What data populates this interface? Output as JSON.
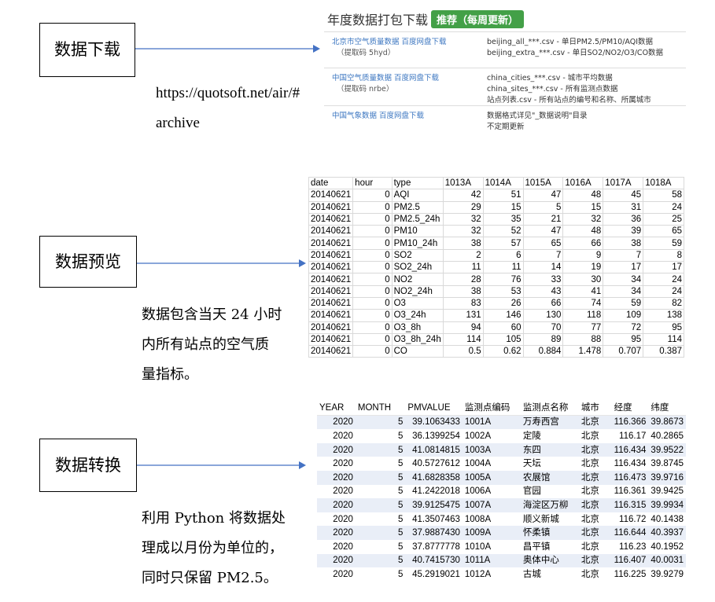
{
  "labels": {
    "download": "数据下载",
    "preview": "数据预览",
    "transform": "数据转换"
  },
  "url_text": [
    "https://quotsoft.net/air/#",
    "archive"
  ],
  "preview_desc": [
    "数据包含当天 24 小时",
    "内所有站点的空气质",
    "量指标。"
  ],
  "transform_desc": [
    "利用 Python 将数据处",
    "理成以月份为单位的，",
    "同时只保留 PM2.5。"
  ],
  "download_panel": {
    "title": "年度数据打包下载",
    "badge": "推荐（每周更新）",
    "rows": [
      {
        "link": "北京市空气质量数据 百度网盘下载",
        "code": "（提取码 5hyd）",
        "desc": [
          "beijing_all_***.csv - 单日PM2.5/PM10/AQI数据",
          "beijing_extra_***.csv - 单日SO2/NO2/O3/CO数据"
        ]
      },
      {
        "link": "中国空气质量数据 百度网盘下载",
        "code": "（提取码 nrbe）",
        "desc": [
          "china_cities_***.csv - 城市平均数据",
          "china_sites_***.csv - 所有监测点数据",
          "站点列表.csv - 所有站点的编号和名称、所属城市"
        ]
      },
      {
        "link": "中国气象数据 百度网盘下载",
        "code": "",
        "desc": [
          "数据格式详见\"_数据说明\"目录",
          "不定期更新"
        ]
      }
    ]
  },
  "preview_table": {
    "headers": [
      "date",
      "hour",
      "type",
      "1013A",
      "1014A",
      "1015A",
      "1016A",
      "1017A",
      "1018A"
    ],
    "rows": [
      [
        "20140621",
        "0",
        "AQI",
        "42",
        "51",
        "47",
        "48",
        "45",
        "58"
      ],
      [
        "20140621",
        "0",
        "PM2.5",
        "29",
        "15",
        "5",
        "15",
        "31",
        "24"
      ],
      [
        "20140621",
        "0",
        "PM2.5_24h",
        "32",
        "35",
        "21",
        "32",
        "36",
        "25"
      ],
      [
        "20140621",
        "0",
        "PM10",
        "32",
        "52",
        "47",
        "48",
        "39",
        "65"
      ],
      [
        "20140621",
        "0",
        "PM10_24h",
        "38",
        "57",
        "65",
        "66",
        "38",
        "59"
      ],
      [
        "20140621",
        "0",
        "SO2",
        "2",
        "6",
        "7",
        "9",
        "7",
        "8"
      ],
      [
        "20140621",
        "0",
        "SO2_24h",
        "11",
        "11",
        "14",
        "19",
        "17",
        "17"
      ],
      [
        "20140621",
        "0",
        "NO2",
        "28",
        "76",
        "33",
        "30",
        "34",
        "24"
      ],
      [
        "20140621",
        "0",
        "NO2_24h",
        "38",
        "53",
        "43",
        "41",
        "34",
        "24"
      ],
      [
        "20140621",
        "0",
        "O3",
        "83",
        "26",
        "66",
        "74",
        "59",
        "82"
      ],
      [
        "20140621",
        "0",
        "O3_24h",
        "131",
        "146",
        "130",
        "118",
        "109",
        "138"
      ],
      [
        "20140621",
        "0",
        "O3_8h",
        "94",
        "60",
        "70",
        "77",
        "72",
        "95"
      ],
      [
        "20140621",
        "0",
        "O3_8h_24h",
        "114",
        "105",
        "89",
        "88",
        "95",
        "114"
      ],
      [
        "20140621",
        "0",
        "CO",
        "0.5",
        "0.62",
        "0.884",
        "1.478",
        "0.707",
        "0.387"
      ]
    ]
  },
  "transform_table": {
    "headers": [
      "YEAR",
      "MONTH",
      "PMVALUE",
      "监测点编码",
      "监测点名称",
      "城市",
      "经度",
      "纬度"
    ],
    "rows": [
      [
        "2020",
        "5",
        "39.1063433",
        "1001A",
        "万寿西宫",
        "北京",
        "116.366",
        "39.8673"
      ],
      [
        "2020",
        "5",
        "36.1399254",
        "1002A",
        "定陵",
        "北京",
        "116.17",
        "40.2865"
      ],
      [
        "2020",
        "5",
        "41.0814815",
        "1003A",
        "东四",
        "北京",
        "116.434",
        "39.9522"
      ],
      [
        "2020",
        "5",
        "40.5727612",
        "1004A",
        "天坛",
        "北京",
        "116.434",
        "39.8745"
      ],
      [
        "2020",
        "5",
        "41.6828358",
        "1005A",
        "农展馆",
        "北京",
        "116.473",
        "39.9716"
      ],
      [
        "2020",
        "5",
        "41.2422018",
        "1006A",
        "官园",
        "北京",
        "116.361",
        "39.9425"
      ],
      [
        "2020",
        "5",
        "39.9125475",
        "1007A",
        "海淀区万柳",
        "北京",
        "116.315",
        "39.9934"
      ],
      [
        "2020",
        "5",
        "41.3507463",
        "1008A",
        "顺义新城",
        "北京",
        "116.72",
        "40.1438"
      ],
      [
        "2020",
        "5",
        "37.9887430",
        "1009A",
        "怀柔镇",
        "北京",
        "116.644",
        "40.3937"
      ],
      [
        "2020",
        "5",
        "37.8777778",
        "1010A",
        "昌平镇",
        "北京",
        "116.23",
        "40.1952"
      ],
      [
        "2020",
        "5",
        "40.7415730",
        "1011A",
        "奥体中心",
        "北京",
        "116.407",
        "40.0031"
      ],
      [
        "2020",
        "5",
        "45.2919021",
        "1012A",
        "古城",
        "北京",
        "116.225",
        "39.9279"
      ]
    ]
  }
}
